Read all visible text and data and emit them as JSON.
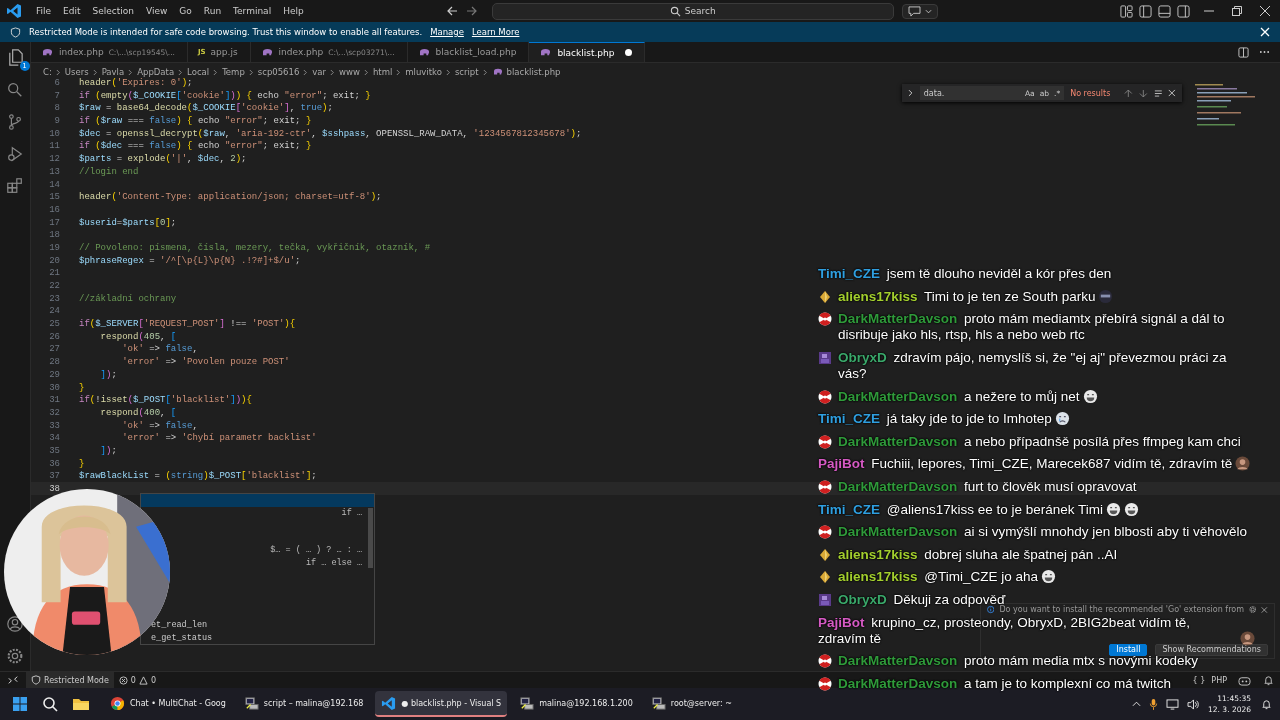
{
  "title_bar": {
    "menus": [
      "File",
      "Edit",
      "Selection",
      "View",
      "Go",
      "Run",
      "Terminal",
      "Help"
    ],
    "search_placeholder": "Search"
  },
  "banner": {
    "text": "Restricted Mode is intended for safe code browsing. Trust this window to enable all features.",
    "links": [
      "Manage",
      "Learn More"
    ]
  },
  "activity_bar": {
    "explorer_badge": "1"
  },
  "tabs": [
    {
      "label": "index.php",
      "description": "C:\\...\\scp19545\\...",
      "kind": "php",
      "selected": false,
      "dirty": false
    },
    {
      "label": "app.js",
      "kind": "js",
      "icon_text": "JS",
      "selected": false,
      "dirty": false
    },
    {
      "label": "index.php",
      "description": "C:\\...\\scp03271\\...",
      "kind": "php",
      "selected": false,
      "dirty": false
    },
    {
      "label": "blacklist_load.php",
      "kind": "php",
      "selected": false,
      "dirty": false
    },
    {
      "label": "blacklist.php",
      "kind": "php",
      "selected": true,
      "dirty": true
    }
  ],
  "breadcrumb": [
    {
      "label": "C:",
      "kind": "folder"
    },
    {
      "label": "Users",
      "kind": "folder"
    },
    {
      "label": "Pavla",
      "kind": "folder"
    },
    {
      "label": "AppData",
      "kind": "folder"
    },
    {
      "label": "Local",
      "kind": "folder"
    },
    {
      "label": "Temp",
      "kind": "folder"
    },
    {
      "label": "scp05616",
      "kind": "folder"
    },
    {
      "label": "var",
      "kind": "folder"
    },
    {
      "label": "www",
      "kind": "folder"
    },
    {
      "label": "html",
      "kind": "folder"
    },
    {
      "label": "mluvitko",
      "kind": "folder"
    },
    {
      "label": "script",
      "kind": "folder"
    },
    {
      "label": "blacklist.php",
      "kind": "php"
    }
  ],
  "find": {
    "value": "data.",
    "options": [
      "Aa",
      "ab",
      ".*"
    ],
    "result": "No results"
  },
  "code": [
    {
      "n": "6",
      "current": false,
      "segs": [
        {
          "text": "header",
          "kind": "function"
        },
        {
          "text": "(",
          "kind": "bracket1"
        },
        {
          "text": "'Expires: 0'",
          "kind": "string"
        },
        {
          "text": ")",
          "kind": "bracket1"
        },
        {
          "text": ";",
          "kind": "plain"
        }
      ]
    },
    {
      "n": "7",
      "current": false,
      "segs": [
        {
          "text": "if",
          "kind": "keyword"
        },
        {
          "text": " (",
          "kind": "bracket1"
        },
        {
          "text": "empty",
          "kind": "function"
        },
        {
          "text": "(",
          "kind": "bracket2"
        },
        {
          "text": "$_COOKIE",
          "kind": "variable"
        },
        {
          "text": "[",
          "kind": "bracket3"
        },
        {
          "text": "'cookie'",
          "kind": "string"
        },
        {
          "text": "]",
          "kind": "bracket3"
        },
        {
          "text": ")",
          "kind": "bracket2"
        },
        {
          "text": ")",
          "kind": "bracket1"
        },
        {
          "text": " {",
          "kind": "bracket1"
        },
        {
          "text": " echo ",
          "kind": "plain"
        },
        {
          "text": "\"error\"",
          "kind": "string"
        },
        {
          "text": "; exit; ",
          "kind": "plain"
        },
        {
          "text": "}",
          "kind": "bracket1"
        }
      ]
    },
    {
      "n": "8",
      "current": false,
      "segs": [
        {
          "text": "$raw",
          "kind": "variable"
        },
        {
          "text": " = ",
          "kind": "plain"
        },
        {
          "text": "base64_decode",
          "kind": "function"
        },
        {
          "text": "(",
          "kind": "bracket1"
        },
        {
          "text": "$_COOKIE",
          "kind": "variable"
        },
        {
          "text": "[",
          "kind": "bracket2"
        },
        {
          "text": "'cookie'",
          "kind": "string"
        },
        {
          "text": "]",
          "kind": "bracket2"
        },
        {
          "text": ", ",
          "kind": "plain"
        },
        {
          "text": "true",
          "kind": "constant"
        },
        {
          "text": ")",
          "kind": "bracket1"
        },
        {
          "text": ";",
          "kind": "plain"
        }
      ]
    },
    {
      "n": "9",
      "current": false,
      "segs": [
        {
          "text": "if",
          "kind": "keyword"
        },
        {
          "text": " (",
          "kind": "bracket1"
        },
        {
          "text": "$raw",
          "kind": "variable"
        },
        {
          "text": " === ",
          "kind": "plain"
        },
        {
          "text": "false",
          "kind": "constant"
        },
        {
          "text": ")",
          "kind": "bracket1"
        },
        {
          "text": " {",
          "kind": "bracket1"
        },
        {
          "text": " echo ",
          "kind": "plain"
        },
        {
          "text": "\"error\"",
          "kind": "string"
        },
        {
          "text": "; exit; ",
          "kind": "plain"
        },
        {
          "text": "}",
          "kind": "bracket1"
        }
      ]
    },
    {
      "n": "10",
      "current": false,
      "segs": [
        {
          "text": "$dec",
          "kind": "variable"
        },
        {
          "text": " = ",
          "kind": "plain"
        },
        {
          "text": "openssl_decrypt",
          "kind": "function"
        },
        {
          "text": "(",
          "kind": "bracket1"
        },
        {
          "text": "$raw",
          "kind": "variable"
        },
        {
          "text": ", ",
          "kind": "plain"
        },
        {
          "text": "'aria-192-ctr'",
          "kind": "string"
        },
        {
          "text": ", ",
          "kind": "plain"
        },
        {
          "text": "$sshpass",
          "kind": "variable"
        },
        {
          "text": ", OPENSSL_RAW_DATA, ",
          "kind": "plain"
        },
        {
          "text": "'1234567812345678'",
          "kind": "string"
        },
        {
          "text": ")",
          "kind": "bracket1"
        },
        {
          "text": ";",
          "kind": "plain"
        }
      ]
    },
    {
      "n": "11",
      "current": false,
      "segs": [
        {
          "text": "if",
          "kind": "keyword"
        },
        {
          "text": " (",
          "kind": "bracket1"
        },
        {
          "text": "$dec",
          "kind": "variable"
        },
        {
          "text": " === ",
          "kind": "plain"
        },
        {
          "text": "false",
          "kind": "constant"
        },
        {
          "text": ")",
          "kind": "bracket1"
        },
        {
          "text": " {",
          "kind": "bracket1"
        },
        {
          "text": " echo ",
          "kind": "plain"
        },
        {
          "text": "\"error\"",
          "kind": "string"
        },
        {
          "text": "; exit; ",
          "kind": "plain"
        },
        {
          "text": "}",
          "kind": "bracket1"
        }
      ]
    },
    {
      "n": "12",
      "current": false,
      "segs": [
        {
          "text": "$parts",
          "kind": "variable"
        },
        {
          "text": " = ",
          "kind": "plain"
        },
        {
          "text": "explode",
          "kind": "function"
        },
        {
          "text": "(",
          "kind": "bracket1"
        },
        {
          "text": "'|'",
          "kind": "string"
        },
        {
          "text": ", ",
          "kind": "plain"
        },
        {
          "text": "$dec",
          "kind": "variable"
        },
        {
          "text": ", ",
          "kind": "plain"
        },
        {
          "text": "2",
          "kind": "number"
        },
        {
          "text": ")",
          "kind": "bracket1"
        },
        {
          "text": ";",
          "kind": "plain"
        }
      ]
    },
    {
      "n": "13",
      "current": false,
      "segs": [
        {
          "text": "//login end",
          "kind": "comment"
        }
      ]
    },
    {
      "n": "14",
      "current": false
    },
    {
      "n": "15",
      "current": false,
      "segs": [
        {
          "text": "header",
          "kind": "function"
        },
        {
          "text": "(",
          "kind": "bracket1"
        },
        {
          "text": "'Content-Type: application/json; charset=utf-8'",
          "kind": "string"
        },
        {
          "text": ")",
          "kind": "bracket1"
        },
        {
          "text": ";",
          "kind": "plain"
        }
      ]
    },
    {
      "n": "16",
      "current": false
    },
    {
      "n": "17",
      "current": false,
      "segs": [
        {
          "text": "$userid",
          "kind": "variable"
        },
        {
          "text": "=",
          "kind": "plain"
        },
        {
          "text": "$parts",
          "kind": "variable"
        },
        {
          "text": "[",
          "kind": "bracket1"
        },
        {
          "text": "0",
          "kind": "number"
        },
        {
          "text": "]",
          "kind": "bracket1"
        },
        {
          "text": ";",
          "kind": "plain"
        }
      ]
    },
    {
      "n": "18",
      "current": false
    },
    {
      "n": "19",
      "current": false,
      "segs": [
        {
          "text": "// Povoleno: písmena, čísla, mezery, tečka, vykřičník, otazník, #",
          "kind": "comment"
        }
      ]
    },
    {
      "n": "20",
      "current": false,
      "segs": [
        {
          "text": "$phraseRegex",
          "kind": "variable"
        },
        {
          "text": " = ",
          "kind": "plain"
        },
        {
          "text": "'/^[\\p{L}\\p{N} .!?#]+$/u'",
          "kind": "string"
        },
        {
          "text": ";",
          "kind": "plain"
        }
      ]
    },
    {
      "n": "21",
      "current": false
    },
    {
      "n": "22",
      "current": false
    },
    {
      "n": "23",
      "current": false,
      "segs": [
        {
          "text": "//základní ochrany",
          "kind": "comment"
        }
      ]
    },
    {
      "n": "24",
      "current": false
    },
    {
      "n": "25",
      "current": false,
      "segs": [
        {
          "text": "if",
          "kind": "keyword"
        },
        {
          "text": "(",
          "kind": "bracket1"
        },
        {
          "text": "$_SERVER",
          "kind": "variable"
        },
        {
          "text": "[",
          "kind": "bracket2"
        },
        {
          "text": "'REQUEST_POST'",
          "kind": "string"
        },
        {
          "text": "]",
          "kind": "bracket2"
        },
        {
          "text": " !== ",
          "kind": "plain"
        },
        {
          "text": "'POST'",
          "kind": "string"
        },
        {
          "text": ")",
          "kind": "bracket1"
        },
        {
          "text": "{",
          "kind": "bracket1"
        }
      ]
    },
    {
      "n": "26",
      "current": false,
      "segs": [
        {
          "text": "    respond",
          "kind": "function"
        },
        {
          "text": "(",
          "kind": "bracket2"
        },
        {
          "text": "405",
          "kind": "number"
        },
        {
          "text": ", ",
          "kind": "plain"
        },
        {
          "text": "[",
          "kind": "bracket3"
        }
      ]
    },
    {
      "n": "27",
      "current": false,
      "segs": [
        {
          "text": "        'ok'",
          "kind": "string"
        },
        {
          "text": " => ",
          "kind": "plain"
        },
        {
          "text": "false",
          "kind": "constant"
        },
        {
          "text": ",",
          "kind": "plain"
        }
      ]
    },
    {
      "n": "28",
      "current": false,
      "segs": [
        {
          "text": "        'error'",
          "kind": "string"
        },
        {
          "text": " => ",
          "kind": "plain"
        },
        {
          "text": "'Povolen pouze POST'",
          "kind": "string"
        }
      ]
    },
    {
      "n": "29",
      "current": false,
      "segs": [
        {
          "text": "    ]",
          "kind": "bracket3"
        },
        {
          "text": ")",
          "kind": "bracket2"
        },
        {
          "text": ";",
          "kind": "plain"
        }
      ]
    },
    {
      "n": "30",
      "current": false,
      "segs": [
        {
          "text": "}",
          "kind": "bracket1"
        }
      ]
    },
    {
      "n": "31",
      "current": false,
      "segs": [
        {
          "text": "if",
          "kind": "keyword"
        },
        {
          "text": "(",
          "kind": "bracket1"
        },
        {
          "text": "!",
          "kind": "plain"
        },
        {
          "text": "isset",
          "kind": "function"
        },
        {
          "text": "(",
          "kind": "bracket2"
        },
        {
          "text": "$_POST",
          "kind": "variable"
        },
        {
          "text": "[",
          "kind": "bracket3"
        },
        {
          "text": "'blacklist'",
          "kind": "string"
        },
        {
          "text": "]",
          "kind": "bracket3"
        },
        {
          "text": ")",
          "kind": "bracket2"
        },
        {
          "text": ")",
          "kind": "bracket1"
        },
        {
          "text": "{",
          "kind": "bracket1"
        }
      ]
    },
    {
      "n": "32",
      "current": false,
      "segs": [
        {
          "text": "    respond",
          "kind": "function"
        },
        {
          "text": "(",
          "kind": "bracket2"
        },
        {
          "text": "400",
          "kind": "number"
        },
        {
          "text": ", ",
          "kind": "plain"
        },
        {
          "text": "[",
          "kind": "bracket3"
        }
      ]
    },
    {
      "n": "33",
      "current": false,
      "segs": [
        {
          "text": "        'ok'",
          "kind": "string"
        },
        {
          "text": " => ",
          "kind": "plain"
        },
        {
          "text": "false",
          "kind": "constant"
        },
        {
          "text": ",",
          "kind": "plain"
        }
      ]
    },
    {
      "n": "34",
      "current": false,
      "segs": [
        {
          "text": "        'error'",
          "kind": "string"
        },
        {
          "text": " => ",
          "kind": "plain"
        },
        {
          "text": "'Chybí parametr backlist'",
          "kind": "string"
        }
      ]
    },
    {
      "n": "35",
      "current": false,
      "segs": [
        {
          "text": "    ]",
          "kind": "bracket3"
        },
        {
          "text": ")",
          "kind": "bracket2"
        },
        {
          "text": ";",
          "kind": "plain"
        }
      ]
    },
    {
      "n": "36",
      "current": false,
      "segs": [
        {
          "text": "}",
          "kind": "bracket1"
        }
      ]
    },
    {
      "n": "37",
      "current": false,
      "segs": [
        {
          "text": "$rawBlackList",
          "kind": "variable"
        },
        {
          "text": " = ",
          "kind": "plain"
        },
        {
          "text": "(",
          "kind": "bracket1"
        },
        {
          "text": "string",
          "kind": "constant"
        },
        {
          "text": ")",
          "kind": "bracket1"
        },
        {
          "text": "$_POST",
          "kind": "variable"
        },
        {
          "text": "[",
          "kind": "bracket1"
        },
        {
          "text": "'blacklist'",
          "kind": "string"
        },
        {
          "text": "]",
          "kind": "bracket1"
        },
        {
          "text": ";",
          "kind": "plain"
        }
      ]
    },
    {
      "n": "38",
      "current": true
    }
  ],
  "suggest": [
    {
      "selected": true
    },
    {
      "detail": "if …",
      "selected": false
    },
    {
      "selected": false
    },
    {
      "selected": false
    },
    {
      "detail": "$… = ( … ) ? … : …",
      "selected": false
    },
    {
      "detail": "if … else …",
      "selected": false
    },
    {
      "selected": false
    },
    {
      "selected": false
    },
    {
      "selected": false
    },
    {
      "selected": false
    },
    {
      "label": "et_read_len",
      "selected": false
    },
    {
      "label": "e_get_status",
      "selected": false
    }
  ],
  "chat": [
    {
      "kind": "none",
      "user": "Timi_CZE",
      "color": "#2f9fe0",
      "text": "jsem tě dlouho neviděl a kór přes den"
    },
    {
      "kind": "gem",
      "user": "aliens17kiss",
      "color": "#a3cf2e",
      "text": "Timi to je ten ze South parku",
      "emotes": [
        {
          "kind": "ninja"
        }
      ]
    },
    {
      "kind": "umbrella",
      "user": "DarkMatterDavson",
      "color": "#2f9a3a",
      "text": "proto mám mediamtx přebírá signál a dál to disribuje jako hls, rtsp, hls a nebo web rtc"
    },
    {
      "kind": "pixel",
      "user": "ObryxD",
      "color": "#3aa86a",
      "text": "zdravím pájo, nemyslíš si, že \"ej aj\" převezmou práci za vás?"
    },
    {
      "kind": "umbrella",
      "user": "DarkMatterDavson",
      "color": "#2f9a3a",
      "text": "a nežere to můj net",
      "emotes": [
        {
          "kind": "grin"
        }
      ]
    },
    {
      "kind": "none",
      "user": "Timi_CZE",
      "color": "#2f9fe0",
      "text": "já taky jde to jde to Imhotep",
      "emotes": [
        {
          "kind": "cry"
        }
      ]
    },
    {
      "kind": "umbrella",
      "user": "DarkMatterDavson",
      "color": "#2f9a3a",
      "text": "a nebo případnšě posílá přes ffmpeg kam chci"
    },
    {
      "kind": "none",
      "user": "PajiBot",
      "color": "#d65ac4",
      "text": "Fuchiii, lepores, Timi_CZE, Marecek687 vidím tě, zdravím tě",
      "emotes": [
        {
          "kind": "avatar"
        }
      ]
    },
    {
      "kind": "umbrella",
      "user": "DarkMatterDavson",
      "color": "#2f9a3a",
      "text": "furt to člověk musí opravovat"
    },
    {
      "kind": "none",
      "user": "Timi_CZE",
      "color": "#2f9fe0",
      "text": "@aliens17kiss ee to je beránek Timi",
      "emotes": [
        {
          "kind": "grin"
        },
        {
          "kind": "grin"
        }
      ]
    },
    {
      "kind": "umbrella",
      "user": "DarkMatterDavson",
      "color": "#2f9a3a",
      "text": "ai si vymýšlí mnohdy jen blbosti aby ti věhovělo"
    },
    {
      "kind": "gem",
      "user": "aliens17kiss",
      "color": "#a3cf2e",
      "text": "dobrej sluha ale špatnej pán ..AI"
    },
    {
      "kind": "gem",
      "user": "aliens17kiss",
      "color": "#a3cf2e",
      "text": "@Timi_CZE jo aha",
      "emotes": [
        {
          "kind": "grin"
        }
      ]
    },
    {
      "kind": "pixel",
      "user": "ObryxD",
      "color": "#3aa86a",
      "text": "Děkuji za odpověď"
    },
    {
      "kind": "none",
      "user": "PajiBot",
      "color": "#d65ac4",
      "text": "krupino_cz, prosteondy, ObryxD, 2BIG2beat vidím tě, zdravím tě",
      "emotes": [
        {
          "kind": "avatar"
        }
      ]
    },
    {
      "kind": "umbrella",
      "user": "DarkMatterDavson",
      "color": "#2f9a3a",
      "text": "proto mám media mtx s novými kodeky"
    },
    {
      "kind": "umbrella",
      "user": "DarkMatterDavson",
      "color": "#2f9a3a",
      "text": "a tam je to komplexní co má twitch"
    }
  ],
  "toast": {
    "message": "Do you want to install the recommended 'Go' extension from",
    "buttons": [
      {
        "label": "Install",
        "primary": true
      },
      {
        "label": "Show Recommendations",
        "primary": false
      }
    ]
  },
  "status_bar": {
    "restricted": "Restricted Mode",
    "errors": "0",
    "warnings": "0",
    "braces": "{ }",
    "language": "PHP"
  },
  "taskbar": {
    "apps": [
      {
        "kind": "chrome",
        "label": "Chat • MultiChat - Goog",
        "selected": false
      },
      {
        "kind": "terminal",
        "label": "script – malina@192.168",
        "selected": false
      },
      {
        "kind": "vscode",
        "label": "● blacklist.php - Visual S",
        "selected": true
      },
      {
        "kind": "terminal",
        "label": "malina@192.168.1.200",
        "selected": false
      },
      {
        "kind": "terminal",
        "label": "root@server: ~",
        "selected": false
      }
    ],
    "time": "11:45:35",
    "date": "12. 3. 2026"
  }
}
